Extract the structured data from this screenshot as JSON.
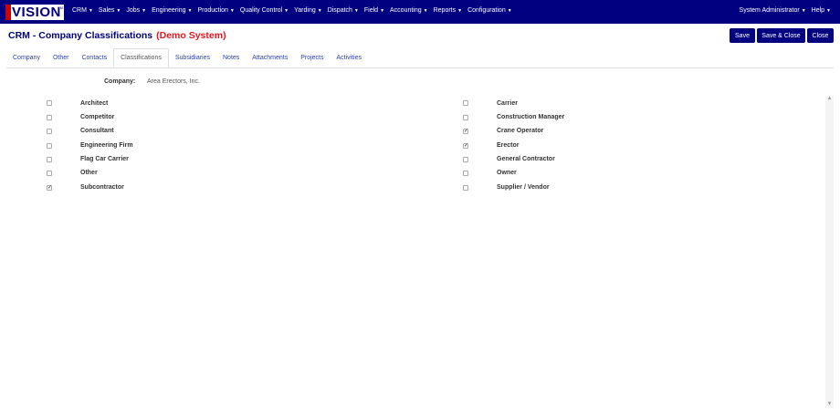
{
  "app": {
    "logo_text": "VISION",
    "logo_tm": "TM"
  },
  "nav": {
    "items": [
      "CRM",
      "Sales",
      "Jobs",
      "Engineering",
      "Production",
      "Quality Control",
      "Yarding",
      "Dispatch",
      "Field",
      "Accounting",
      "Reports",
      "Configuration"
    ],
    "right": [
      "System Administrator",
      "Help"
    ]
  },
  "page": {
    "title": "CRM - Company Classifications",
    "demo_label": "(Demo System)"
  },
  "buttons": {
    "save": "Save",
    "save_close": "Save & Close",
    "close": "Close"
  },
  "tabs": [
    "Company",
    "Other",
    "Contacts",
    "Classifications",
    "Subsidiaries",
    "Notes",
    "Attachments",
    "Projects",
    "Activities"
  ],
  "active_tab": "Classifications",
  "company": {
    "label": "Company:",
    "value": "Area Erectors, Inc."
  },
  "classifications": {
    "left": [
      {
        "label": "Architect",
        "checked": false
      },
      {
        "label": "Competitor",
        "checked": false
      },
      {
        "label": "Consultant",
        "checked": false
      },
      {
        "label": "Engineering Firm",
        "checked": false
      },
      {
        "label": "Flag Car Carrier",
        "checked": false
      },
      {
        "label": "Other",
        "checked": false
      },
      {
        "label": "Subcontractor",
        "checked": true
      }
    ],
    "right": [
      {
        "label": "Carrier",
        "checked": false
      },
      {
        "label": "Construction Manager",
        "checked": false
      },
      {
        "label": "Crane Operator",
        "checked": true
      },
      {
        "label": "Erector",
        "checked": true
      },
      {
        "label": "General Contractor",
        "checked": false
      },
      {
        "label": "Owner",
        "checked": false
      },
      {
        "label": "Supplier / Vendor",
        "checked": false
      }
    ]
  },
  "colors": {
    "nav_bg": "#000080",
    "title": "#000080",
    "demo": "#e8141e",
    "tab_link": "#2a3fb4"
  }
}
